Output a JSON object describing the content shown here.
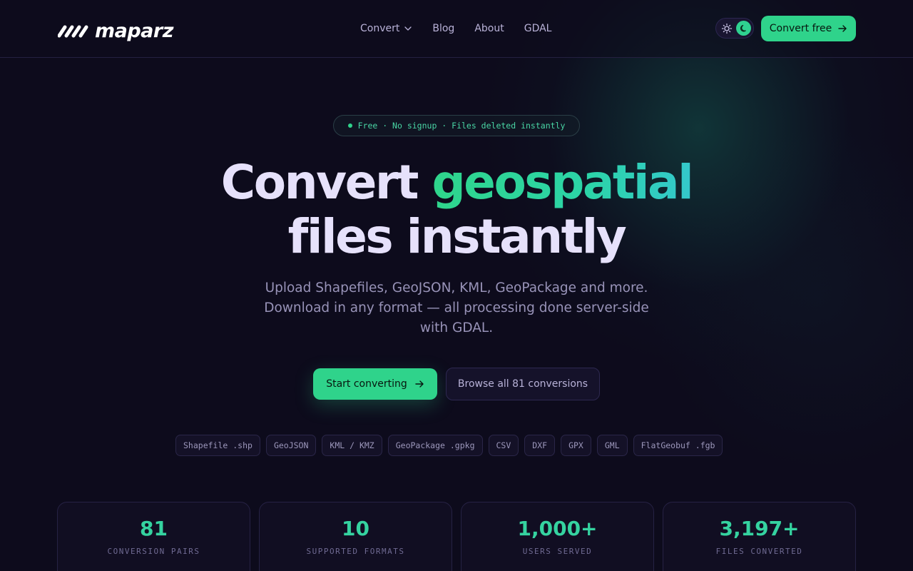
{
  "header": {
    "logo_text": "maparz",
    "nav": [
      {
        "label": "Convert",
        "has_dropdown": true
      },
      {
        "label": "Blog"
      },
      {
        "label": "About"
      },
      {
        "label": "GDAL"
      }
    ],
    "theme_toggle": {
      "light_icon": "sun-icon",
      "dark_icon": "moon-icon",
      "active": "dark"
    },
    "cta_label": "Convert free"
  },
  "hero": {
    "badge": "Free · No signup · Files deleted instantly",
    "headline_part1": "Convert",
    "headline_accent": "geospatial",
    "headline_line2": "files instantly",
    "subtitle": "Upload Shapefiles, GeoJSON, KML, GeoPackage and more. Download in any format — all processing done server-side with GDAL.",
    "primary_button": "Start converting",
    "secondary_button": "Browse all 81 conversions"
  },
  "formats": [
    "Shapefile .shp",
    "GeoJSON",
    "KML / KMZ",
    "GeoPackage .gpkg",
    "CSV",
    "DXF",
    "GPX",
    "GML",
    "FlatGeobuf .fgb"
  ],
  "stats": [
    {
      "value": "81",
      "label": "CONVERSION PAIRS"
    },
    {
      "value": "10",
      "label": "SUPPORTED FORMATS"
    },
    {
      "value": "1,000+",
      "label": "USERS SERVED"
    },
    {
      "value": "3,197+",
      "label": "FILES CONVERTED"
    }
  ],
  "colors": {
    "background": "#0d0b1c",
    "accent": "#2fd38b",
    "accent_teal": "#34c8cc",
    "text": "#e6e1fb",
    "muted": "#9893b8"
  }
}
